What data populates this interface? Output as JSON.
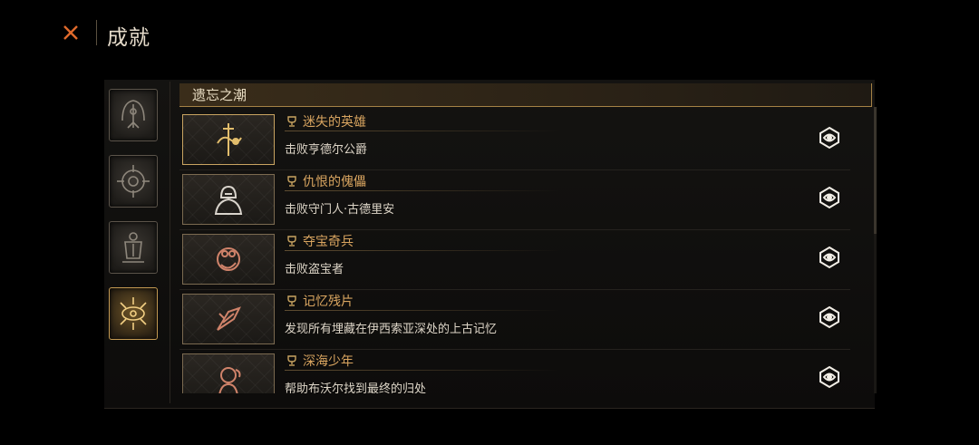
{
  "header": {
    "title": "成就",
    "close_icon": "close-x-icon",
    "accent": "#e06a2c"
  },
  "sidebar": {
    "categories": [
      {
        "icon": "sword-emblem-icon",
        "active": false
      },
      {
        "icon": "compass-rune-icon",
        "active": false
      },
      {
        "icon": "lantern-rune-icon",
        "active": false
      },
      {
        "icon": "eye-crest-icon",
        "active": true
      }
    ]
  },
  "section": {
    "title": "遗忘之潮"
  },
  "achievements": [
    {
      "name": "迷失的英雄",
      "desc": "击败亨德尔公爵",
      "icon": "sword-dragon-icon",
      "trophy": "trophy-icon",
      "status": "eye-unlocked-icon"
    },
    {
      "name": "仇恨的傀儡",
      "desc": "击败守门人·古德里安",
      "icon": "hooded-golem-icon",
      "trophy": "trophy-icon",
      "status": "eye-unlocked-icon"
    },
    {
      "name": "夺宝奇兵",
      "desc": "击败盗宝者",
      "icon": "treasure-thief-icon",
      "trophy": "trophy-icon",
      "status": "eye-unlocked-icon"
    },
    {
      "name": "记忆残片",
      "desc": "发现所有埋藏在伊西索亚深处的上古记忆",
      "icon": "memory-shard-icon",
      "trophy": "trophy-icon",
      "status": "eye-unlocked-icon"
    },
    {
      "name": "深海少年",
      "desc": "帮助布沃尔找到最终的归处",
      "icon": "deep-sea-boy-icon",
      "trophy": "trophy-icon",
      "status": "eye-unlocked-icon"
    }
  ],
  "colors": {
    "gold": "#c9a461",
    "name_text": "#d9a560",
    "background": "#000000"
  }
}
